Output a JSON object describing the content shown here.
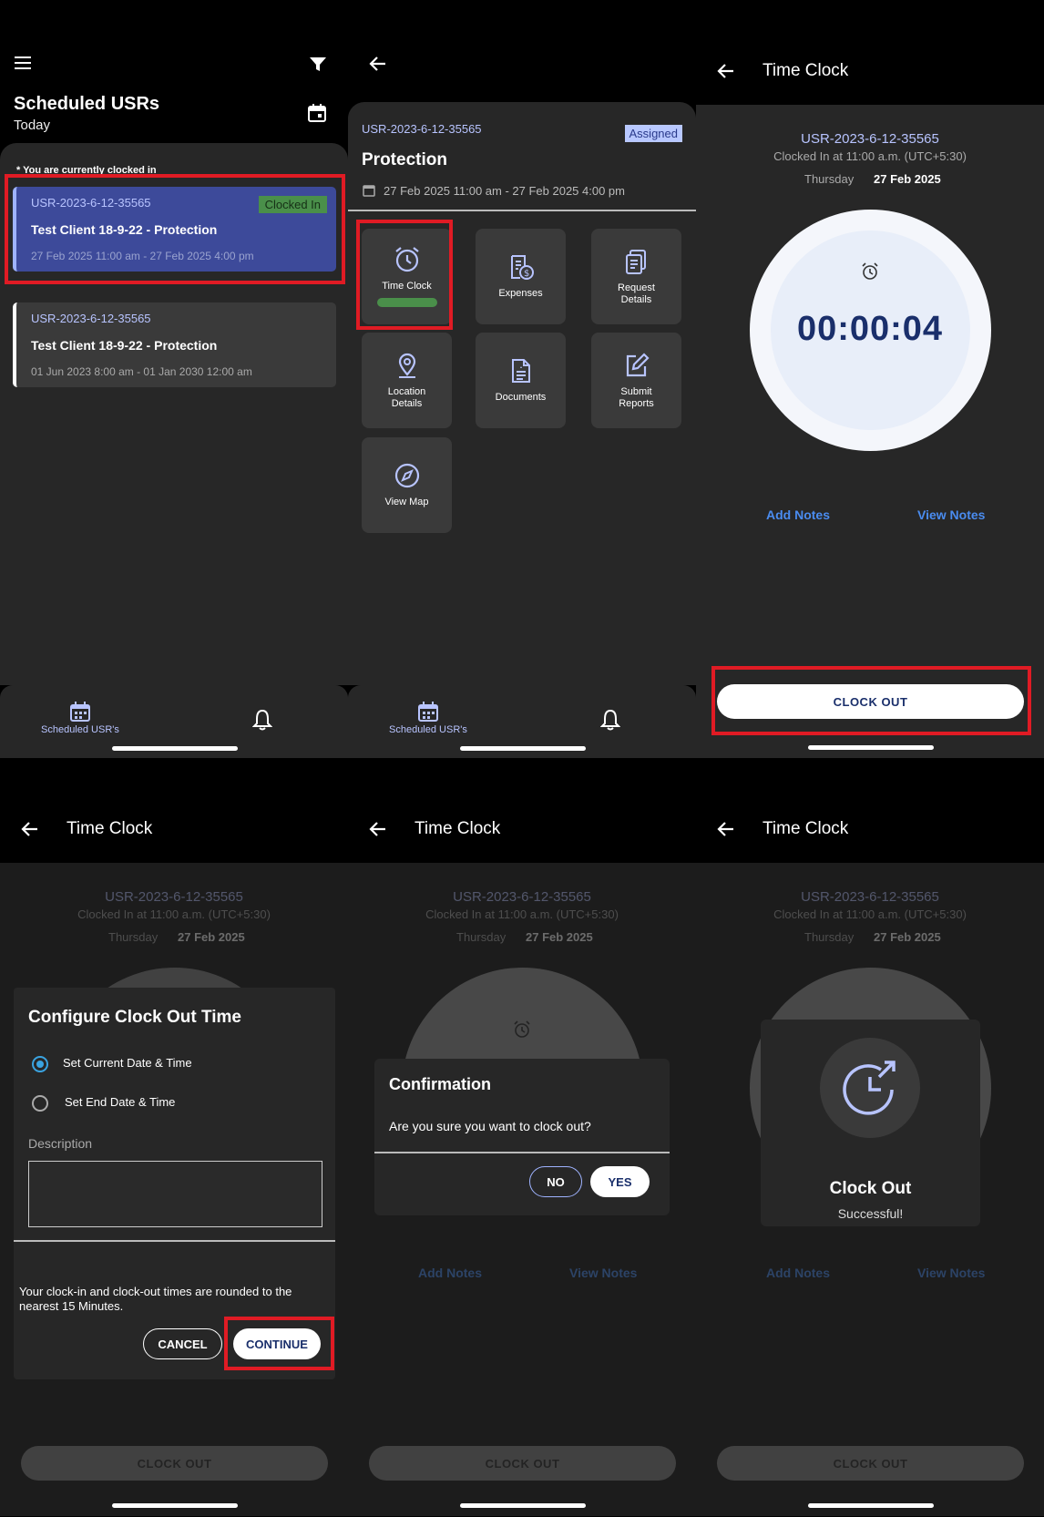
{
  "panel1": {
    "title": "Scheduled USRs",
    "subtitle": "Today",
    "clocked_note": "* You are currently clocked in",
    "cards": [
      {
        "id": "USR-2023-6-12-35565",
        "title": "Test Client 18-9-22 - Protection",
        "date": "27 Feb 2025 11:00 am - 27 Feb 2025 4:00 pm",
        "badge": "Clocked In"
      },
      {
        "id": "USR-2023-6-12-35565",
        "title": "Test Client 18-9-22 - Protection",
        "date": "01 Jun 2023 8:00 am - 01 Jan 2030 12:00 am"
      }
    ],
    "nav_label": "Scheduled USR's"
  },
  "panel2": {
    "id": "USR-2023-6-12-35565",
    "badge": "Assigned",
    "title": "Protection",
    "date": "27 Feb 2025 11:00 am - 27 Feb 2025 4:00 pm",
    "tiles": [
      {
        "label": "Time Clock",
        "icon": "alarm-clock-icon"
      },
      {
        "label": "Expenses",
        "icon": "expenses-icon"
      },
      {
        "label": "Request\nDetails",
        "icon": "request-details-icon"
      },
      {
        "label": "Location\nDetails",
        "icon": "location-pin-icon"
      },
      {
        "label": "Documents",
        "icon": "document-icon"
      },
      {
        "label": "Submit\nReports",
        "icon": "edit-icon"
      },
      {
        "label": "View Map",
        "icon": "compass-icon"
      }
    ],
    "nav_label": "Scheduled USR's"
  },
  "timeclock": {
    "header": "Time Clock",
    "id": "USR-2023-6-12-35565",
    "clocked_in": "Clocked In at 11:00 a.m. (UTC+5:30)",
    "day": "Thursday",
    "date": "27 Feb 2025",
    "elapsed": "00:00:04",
    "add_notes": "Add Notes",
    "view_notes": "View Notes",
    "clock_out": "CLOCK OUT"
  },
  "configure": {
    "title": "Configure Clock Out Time",
    "option1": "Set Current Date & Time",
    "option2": "Set End Date & Time",
    "description_label": "Description",
    "note": "Your clock-in and clock-out times are rounded to the nearest 15 Minutes.",
    "cancel": "CANCEL",
    "continue": "CONTINUE"
  },
  "confirmation": {
    "title": "Confirmation",
    "message": "Are you sure you want to clock out?",
    "no": "NO",
    "yes": "YES"
  },
  "success": {
    "title": "Clock Out",
    "message": "Successful!"
  },
  "colors": {
    "accent_blue": "#1a2f6b",
    "link_blue": "#4a8cf0",
    "card_selected": "#3d4a9a",
    "highlight_red": "#e01b24",
    "badge_green": "#4a8f4a"
  }
}
